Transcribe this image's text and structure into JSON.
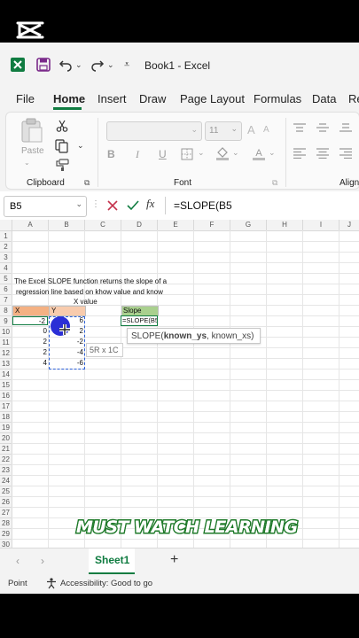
{
  "app": {
    "title": "Book1  -  Excel"
  },
  "tabs": [
    "File",
    "Home",
    "Insert",
    "Draw",
    "Page Layout",
    "Formulas",
    "Data",
    "Re"
  ],
  "ribbon": {
    "paste_label": "Paste",
    "font_size": "11",
    "bold": "B",
    "italic": "I",
    "group_clipboard": "Clipboard",
    "group_font": "Font",
    "group_align": "Alignm"
  },
  "formula_bar": {
    "name_box": "B5",
    "fx": "fx",
    "formula": "=SLOPE(B5"
  },
  "grid": {
    "columns": [
      "A",
      "B",
      "C",
      "D",
      "E",
      "F",
      "G",
      "H",
      "I",
      "J"
    ],
    "rows": [
      "1",
      "2",
      "3",
      "4",
      "5",
      "6",
      "7",
      "8",
      "9",
      "10",
      "11",
      "12",
      "13",
      "14",
      "15",
      "16",
      "17",
      "18",
      "19",
      "20",
      "21",
      "22",
      "23",
      "24",
      "25",
      "26",
      "27",
      "28",
      "29",
      "30"
    ],
    "description_line1": "The Excel SLOPE function returns the slope of a",
    "description_line2": "regression line based on khow value and know",
    "x_value_label": "X value",
    "header_x": "X",
    "header_y": "Y",
    "x_values": [
      "-2",
      "0",
      "2",
      "2",
      "4"
    ],
    "y_values": [
      "6",
      "2",
      "-2",
      "-4",
      "-6"
    ],
    "slope_label": "Slope",
    "slope_formula": "=SLOPE(B5",
    "selection_tooltip": "5R x 1C",
    "fn_hint_prefix": "SLOPE(",
    "fn_hint_bold": "known_ys",
    "fn_hint_suffix": ", known_xs)"
  },
  "sheets": {
    "active": "Sheet1",
    "add": "+"
  },
  "status": {
    "mode": "Point",
    "accessibility": "Accessibility: Good to go"
  },
  "caption": "MUST WATCH LEARNING",
  "colors": {
    "excel_green": "#107c41",
    "x_header_fill": "#f4b183",
    "y_header_fill": "#f8cbad",
    "slope_fill": "#a9d08e",
    "cursor_blue": "#2b2fd6"
  }
}
